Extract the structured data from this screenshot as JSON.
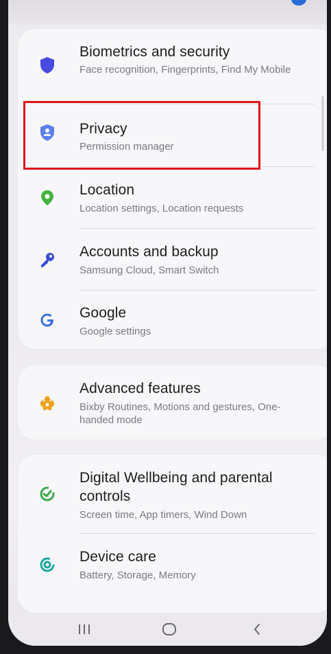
{
  "settings": {
    "items": [
      {
        "title": "Biometrics and security",
        "subtitle": "Face recognition, Fingerprints, Find My Mobile",
        "icon": "shield-icon",
        "color": "#4a4ae0"
      },
      {
        "title": "Privacy",
        "subtitle": "Permission manager",
        "icon": "privacy-shield-icon",
        "color": "#5c7fe8"
      },
      {
        "title": "Location",
        "subtitle": "Location settings, Location requests",
        "icon": "location-pin-icon",
        "color": "#44b33e"
      },
      {
        "title": "Accounts and backup",
        "subtitle": "Samsung Cloud, Smart Switch",
        "icon": "key-icon",
        "color": "#3b4fd4"
      },
      {
        "title": "Google",
        "subtitle": "Google settings",
        "icon": "google-icon",
        "color": "#3c6de0"
      },
      {
        "title": "Advanced features",
        "subtitle": "Bixby Routines, Motions and gestures, One-handed mode",
        "icon": "puzzle-gear-icon",
        "color": "#f0a21c"
      },
      {
        "title": "Digital Wellbeing and parental controls",
        "subtitle": "Screen time, App timers, Wind Down",
        "icon": "wellbeing-icon",
        "color": "#3aa84a"
      },
      {
        "title": "Device care",
        "subtitle": "Battery, Storage, Memory",
        "icon": "device-care-icon",
        "color": "#1aa7a0"
      }
    ]
  },
  "navbar": {
    "recents": "|||",
    "home": "◯",
    "back": "<"
  },
  "highlight_color": "#e0131b"
}
